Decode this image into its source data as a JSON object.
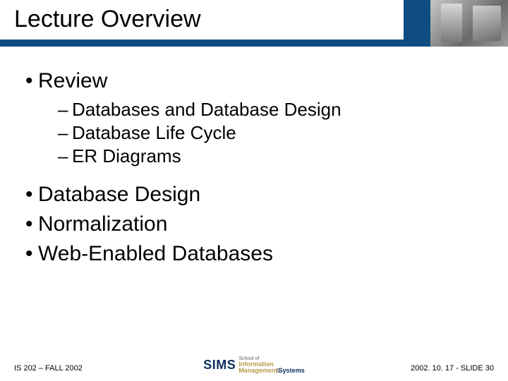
{
  "title": "Lecture Overview",
  "bullets": {
    "b1": "Review",
    "b1_1": "Databases and Database Design",
    "b1_2": "Database Life Cycle",
    "b1_3": "ER Diagrams",
    "b2": "Database Design",
    "b3": "Normalization",
    "b4": "Web-Enabled Databases"
  },
  "footer": {
    "left": "IS 202 – FALL 2002",
    "right": "2002. 10. 17 -  SLIDE 30",
    "logo_main": "SIMS",
    "logo_school": "School of",
    "logo_info": "Information",
    "logo_mgmt": "Management",
    "logo_amp": "&",
    "logo_sys": "Systems"
  }
}
